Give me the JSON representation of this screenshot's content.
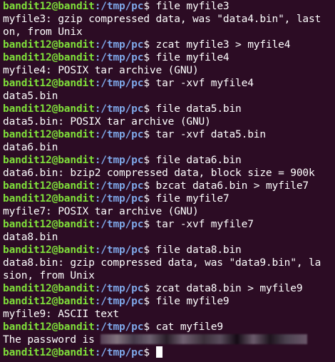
{
  "prompt": {
    "user_host": "bandit12@bandit",
    "path": ":/tmp/pc",
    "symbol": "$ "
  },
  "lines": [
    {
      "type": "cmd",
      "text": "file myfile3"
    },
    {
      "type": "out",
      "text": "myfile3: gzip compressed data, was \"data4.bin\", last"
    },
    {
      "type": "out",
      "text": "on, from Unix"
    },
    {
      "type": "cmd",
      "text": "zcat myfile3 > myfile4"
    },
    {
      "type": "cmd",
      "text": "file myfile4"
    },
    {
      "type": "out",
      "text": "myfile4: POSIX tar archive (GNU)"
    },
    {
      "type": "cmd",
      "text": "tar -xvf myfile4"
    },
    {
      "type": "out",
      "text": "data5.bin"
    },
    {
      "type": "cmd",
      "text": "file data5.bin"
    },
    {
      "type": "out",
      "text": "data5.bin: POSIX tar archive (GNU)"
    },
    {
      "type": "cmd",
      "text": "tar -xvf data5.bin"
    },
    {
      "type": "out",
      "text": "data6.bin"
    },
    {
      "type": "cmd",
      "text": "file data6.bin"
    },
    {
      "type": "out",
      "text": "data6.bin: bzip2 compressed data, block size = 900k"
    },
    {
      "type": "cmd",
      "text": "bzcat data6.bin > myfile7"
    },
    {
      "type": "cmd",
      "text": "file myfile7"
    },
    {
      "type": "out",
      "text": "myfile7: POSIX tar archive (GNU)"
    },
    {
      "type": "cmd",
      "text": "tar -xvf myfile7"
    },
    {
      "type": "out",
      "text": "data8.bin"
    },
    {
      "type": "cmd",
      "text": "file data8.bin"
    },
    {
      "type": "out",
      "text": "data8.bin: gzip compressed data, was \"data9.bin\", la"
    },
    {
      "type": "out",
      "text": "sion, from Unix"
    },
    {
      "type": "cmd",
      "text": "zcat data8.bin > myfile9"
    },
    {
      "type": "cmd",
      "text": "file myfile9"
    },
    {
      "type": "out",
      "text": "myfile9: ASCII text"
    },
    {
      "type": "cmd",
      "text": "cat myfile9"
    },
    {
      "type": "password",
      "text": "The password is "
    },
    {
      "type": "prompt_only",
      "text": ""
    }
  ]
}
